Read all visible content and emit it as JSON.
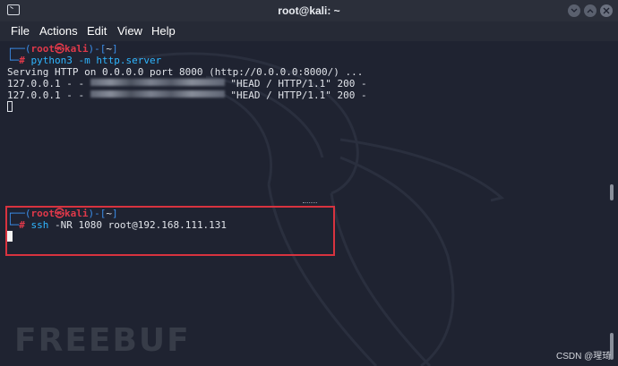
{
  "window": {
    "title": "root@kali: ~"
  },
  "menu": [
    "File",
    "Actions",
    "Edit",
    "View",
    "Help"
  ],
  "pane_top": {
    "prompt_open": "┌──(",
    "prompt_user": "root㉿kali",
    "prompt_mid": ")-[",
    "prompt_dir": "~",
    "prompt_close": "]",
    "prompt2_prefix": "└─",
    "prompt2_hash": "#",
    "command": " python3 -m http.server",
    "output": [
      "Serving HTTP on 0.0.0.0 port 8000 (http://0.0.0.0:8000/) ...",
      "127.0.0.1 - - ",
      " \"HEAD / HTTP/1.1\" 200 -",
      "127.0.0.1 - - ",
      " \"HEAD / HTTP/1.1\" 200 -"
    ]
  },
  "pane_bottom": {
    "prompt_open": "┌──(",
    "prompt_user": "root㉿kali",
    "prompt_mid": ")-[",
    "prompt_dir": "~",
    "prompt_close": "]",
    "prompt2_prefix": "└─",
    "prompt2_hash": "#",
    "command_name": " ssh",
    "command_args": " -NR 1080 root@192.168.111.131"
  },
  "watermark": "FREEBUF",
  "credit": "CSDN @瑆琦",
  "colors": {
    "highlight": "#d8333f",
    "prompt_blue": "#3b8eea",
    "prompt_red": "#e0394a"
  },
  "icons": [
    "terminal-icon",
    "minimize-icon",
    "maximize-icon",
    "close-icon"
  ]
}
